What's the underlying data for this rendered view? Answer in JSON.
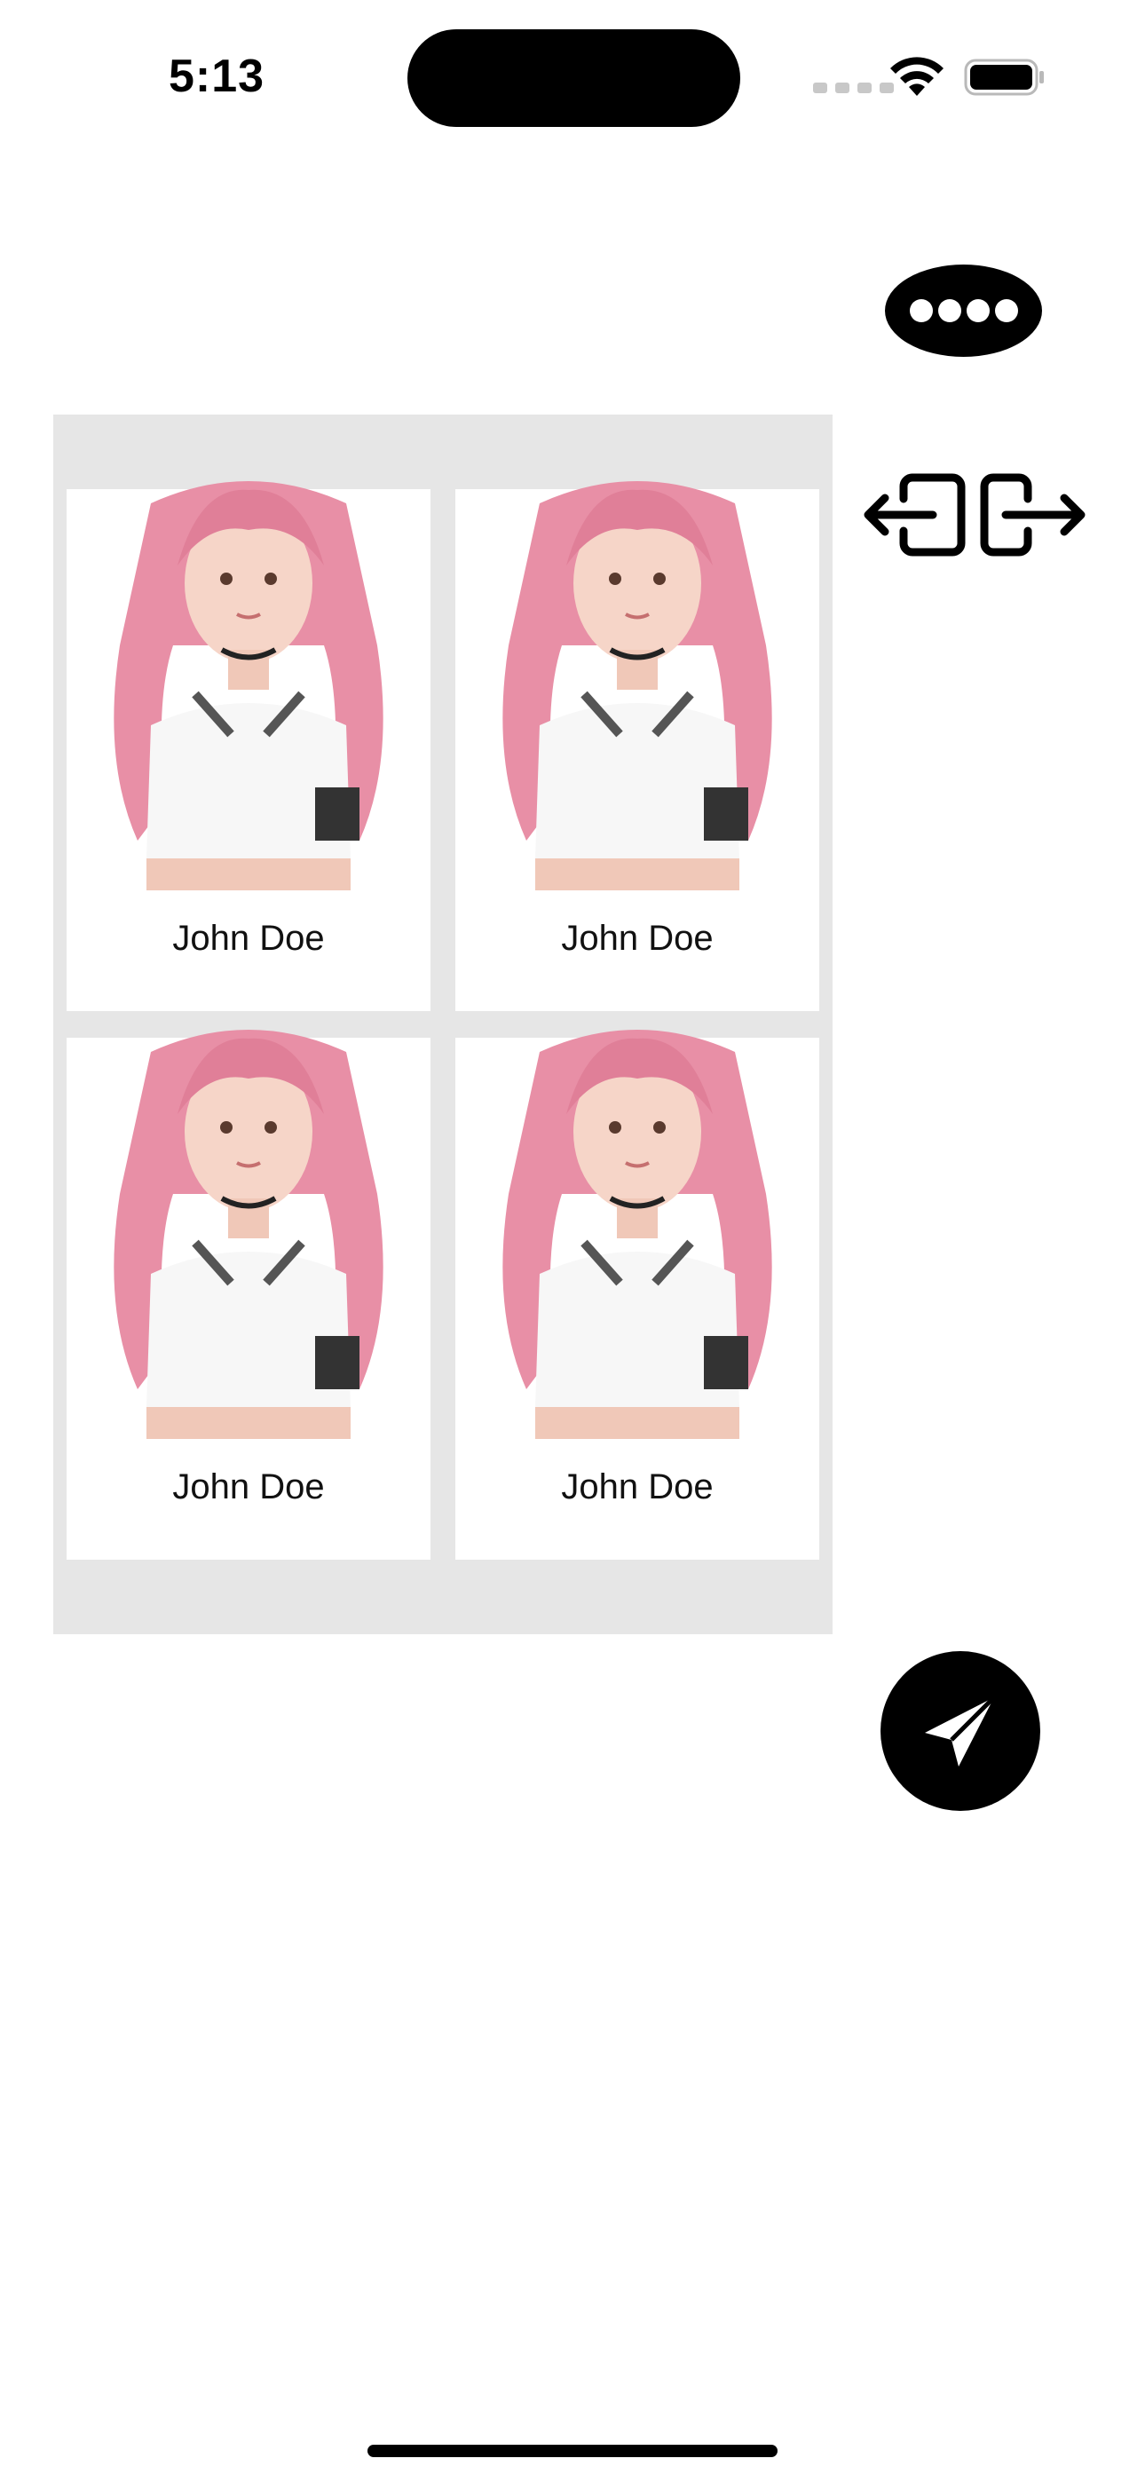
{
  "status_bar": {
    "time": "5:13"
  },
  "icons": {
    "more": "ellipsis-icon",
    "enter": "login-icon",
    "exit": "logout-icon",
    "send": "paper-plane-icon",
    "wifi": "wifi-icon",
    "battery": "battery-icon"
  },
  "grid": {
    "cards": [
      {
        "name": "John Doe"
      },
      {
        "name": "John Doe"
      },
      {
        "name": "John Doe"
      },
      {
        "name": "John Doe"
      }
    ]
  },
  "colors": {
    "panel_background": "#e6e6e6",
    "button_fill": "#000000",
    "hair": "#e88fa6"
  }
}
